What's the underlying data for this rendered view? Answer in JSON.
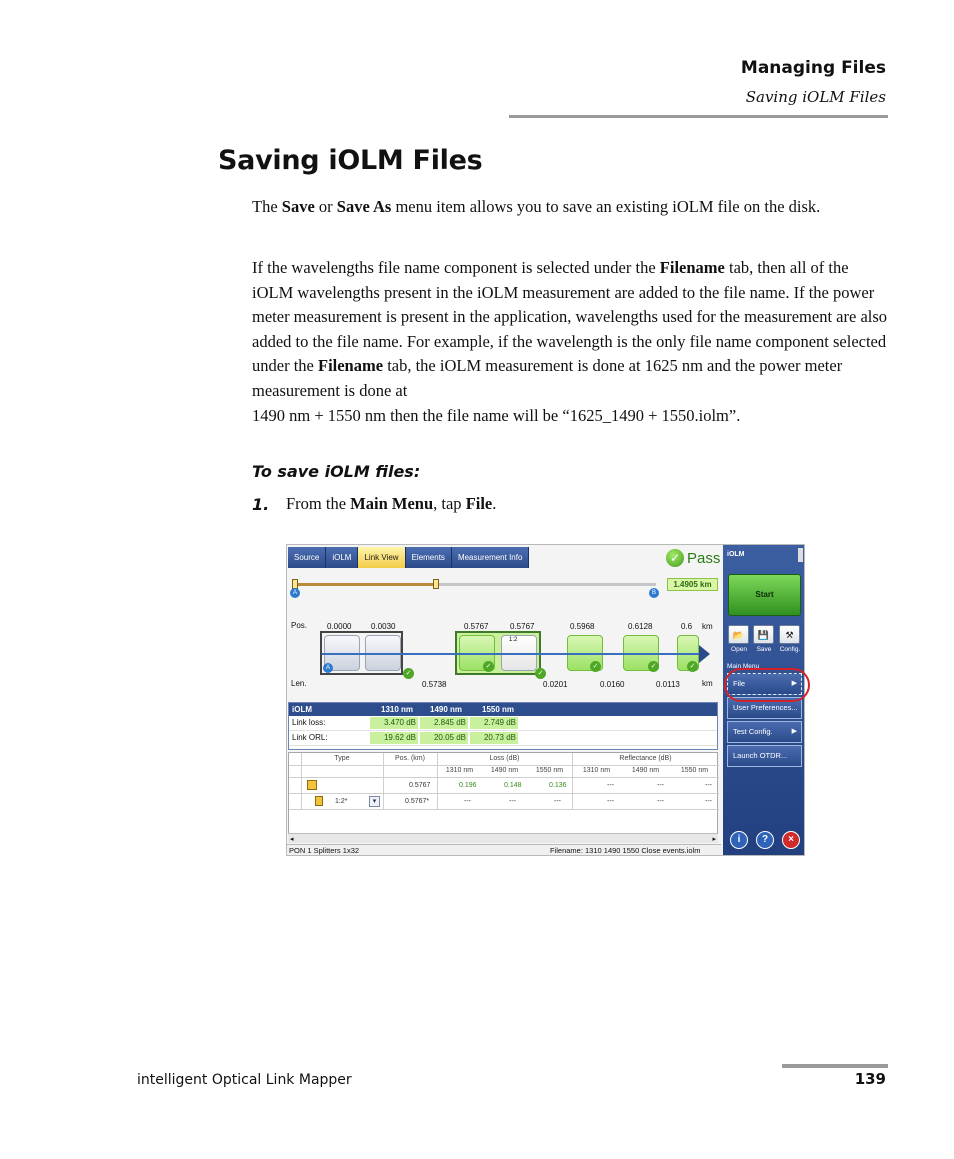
{
  "header": {
    "chapter": "Managing Files",
    "section": "Saving iOLM Files"
  },
  "title": "Saving iOLM Files",
  "para1": {
    "t1": "The ",
    "b1": "Save",
    "t2": " or ",
    "b2": "Save As",
    "t3": " menu item allows you to save an existing iOLM file on the disk."
  },
  "para2": {
    "t1": "If the wavelengths file name component is selected under the ",
    "b1": "Filename",
    "t2": " tab, then all of the iOLM wavelengths present in the iOLM measurement are added to the file name. If the power meter measurement is present in the application, wavelengths used for the measurement are also added to the file name. For example, if the wavelength is the only file name component selected under the ",
    "b2": "Filename",
    "t3": " tab, the iOLM measurement is done at 1625 nm and the power meter measurement is done at",
    "t4": "1490 nm + 1550 nm then the file name will be “1625_1490 + 1550.iolm”."
  },
  "procedure_title": "To save iOLM files:",
  "step1": {
    "num": "1.",
    "t1": "From the ",
    "b1": "Main Menu",
    "t2": ", tap ",
    "b2": "File",
    "t3": "."
  },
  "footer": {
    "left": "intelligent Optical Link Mapper",
    "page": "139"
  },
  "screenshot": {
    "tabs": [
      "Source",
      "iOLM",
      "Link View",
      "Elements",
      "Measurement Info"
    ],
    "active_tab": "Link View",
    "pass_label": "Pass",
    "distance": "1.4905 km",
    "pos_label": "Pos.",
    "len_label": "Len.",
    "km_label": "km",
    "positions": [
      "0.0000",
      "0.0030",
      "0.5767",
      "0.5767",
      "0.5968",
      "0.6128",
      "0.6"
    ],
    "lengths": [
      "0.5738",
      "0.0201",
      "0.0160",
      "0.0113"
    ],
    "splitter_label": "1:2",
    "marker_a": "A",
    "marker_b": "B",
    "iolm_table": {
      "title": "iOLM",
      "wavelengths": [
        "1310 nm",
        "1490 nm",
        "1550 nm"
      ],
      "rows": [
        {
          "label": "Link loss:",
          "values": [
            "3.470 dB",
            "2.845 dB",
            "2.749 dB"
          ]
        },
        {
          "label": "Link ORL:",
          "values": [
            "19.62 dB",
            "20.05 dB",
            "20.73 dB"
          ]
        }
      ]
    },
    "event_table": {
      "col_type": "Type",
      "col_pos": "Pos. (km)",
      "col_loss": "Loss (dB)",
      "col_refl": "Reflectance (dB)",
      "sub": [
        "1310 nm",
        "1490 nm",
        "1550 nm",
        "1310 nm",
        "1490 nm",
        "1550 nm"
      ],
      "row1": {
        "pos": "0.5767",
        "loss": [
          "0.196",
          "0.148",
          "0.136"
        ],
        "refl": [
          "---",
          "---",
          "---"
        ]
      },
      "row2": {
        "type": "1:2*",
        "pos": "0.5767*",
        "loss": [
          "---",
          "---",
          "---"
        ],
        "refl": [
          "---",
          "---",
          "---"
        ]
      }
    },
    "status_left": "PON 1 Splitters 1x32",
    "status_right": "Filename: 1310 1490 1550 Close events.iolm",
    "side": {
      "title": "iOLM",
      "start": "Start",
      "quick": [
        "Open",
        "Save",
        "Config."
      ],
      "menu_head": "Main Menu",
      "menu": [
        "File",
        "User Preferences...",
        "Test Config.",
        "Launch OTDR..."
      ],
      "round": [
        "i",
        "?",
        "×"
      ]
    },
    "colors": {
      "accent": "#2e4d8c",
      "highlight": "#c9f09c",
      "callout": "#d4222a"
    }
  }
}
